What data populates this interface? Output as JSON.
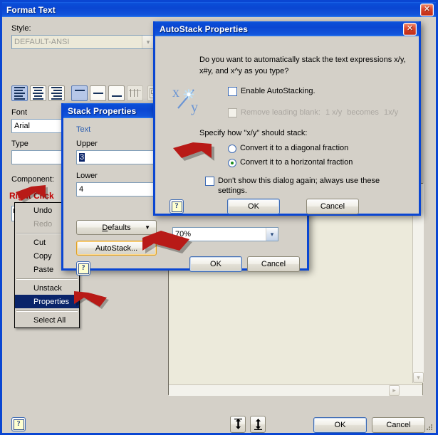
{
  "main_window": {
    "title": "Format Text",
    "close_label": "✕",
    "style_label": "Style:",
    "style_value": "DEFAULT-ANSI",
    "font_label": "Font",
    "font_value": "Arial",
    "type_label": "Type",
    "type_value": "",
    "component_label": "Component:",
    "right_click_note": "Right Click",
    "component_value": "3/4",
    "ok_label": "OK",
    "cancel_label": "Cancel",
    "toolbar": {
      "align_left": "align-left",
      "align_center": "align-center",
      "align_right": "align-right",
      "valign_top": "valign-top",
      "valign_middle": "valign-middle",
      "valign_bottom": "valign-bottom",
      "tab_stops": "tab-stops",
      "text_box": "text-box"
    }
  },
  "context_menu": {
    "items": [
      {
        "label": "Undo",
        "state": "normal"
      },
      {
        "label": "Redo",
        "state": "disabled"
      },
      {
        "label": "Cut",
        "state": "normal"
      },
      {
        "label": "Copy",
        "state": "normal"
      },
      {
        "label": "Paste",
        "state": "normal"
      },
      {
        "label": "Unstack",
        "state": "normal"
      },
      {
        "label": "Properties",
        "state": "selected"
      },
      {
        "label": "Select All",
        "state": "normal"
      }
    ]
  },
  "stack_dialog": {
    "title": "Stack Properties",
    "close_label": "✕",
    "text_group": "Text",
    "upper_label": "Upper",
    "upper_value": "3",
    "lower_label": "Lower",
    "lower_value": "4",
    "defaults_label": "Defaults",
    "defaults_accel": "D",
    "autostack_label": "AutoStack...",
    "size_value": "70%",
    "ok_label": "OK",
    "cancel_label": "Cancel",
    "help_label": "?"
  },
  "autostack_dialog": {
    "title": "AutoStack Properties",
    "close_label": "✕",
    "question_line1": "Do you want to automatically stack the text expressions x/y,",
    "question_line2": "x#y, and x^y as you type?",
    "icon_label": "x/y",
    "enable_label": "Enable AutoStacking.",
    "enable_checked": false,
    "remove_blank_label": "Remove leading blank:",
    "remove_blank_example_a": "1 x/y",
    "remove_blank_example_mid": "becomes",
    "remove_blank_example_b": "1x/y",
    "remove_blank_checked": false,
    "remove_blank_disabled": true,
    "specify_label": "Specify how \"x/y\" should stack:",
    "radio_diagonal": "Convert it to a diagonal fraction",
    "radio_horizontal": "Convert it to a horizontal fraction",
    "radio_selected": "horizontal",
    "dont_show_line1": "Don't show this dialog again; always use these",
    "dont_show_line2": "settings.",
    "dont_show_checked": false,
    "ok_label": "OK",
    "cancel_label": "Cancel",
    "help_label": "?"
  },
  "annotations": {
    "arrow_right_click": "red-arrow-pointing-to-component",
    "arrow_properties": "red-arrow-pointing-to-properties",
    "arrow_autostack": "red-arrow-pointing-to-autostack",
    "arrow_dontshow": "red-arrow-pointing-to-dont-show-checkbox"
  },
  "colors": {
    "title_blue": "#0a46d2",
    "annotation_red": "#c00000",
    "menu_highlight": "#0a246a",
    "editor_bg": "#eceadb",
    "dialog_bg": "#d4d0c8"
  }
}
